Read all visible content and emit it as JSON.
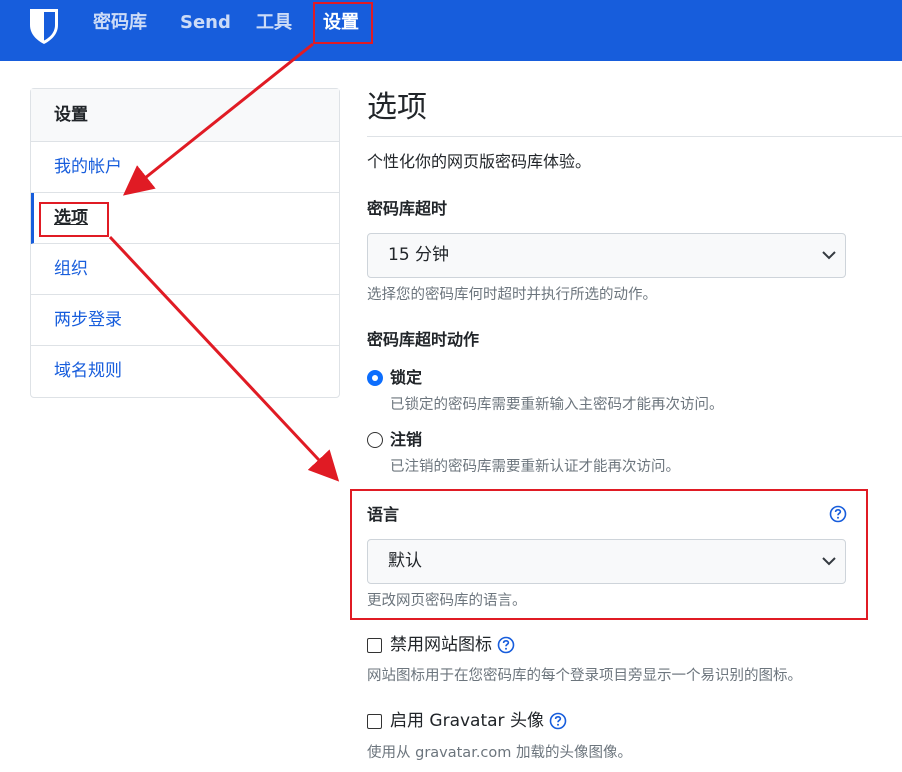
{
  "nav": {
    "items": [
      {
        "label": "密码库"
      },
      {
        "label": "Send"
      },
      {
        "label": "工具"
      },
      {
        "label": "设置"
      }
    ]
  },
  "sidebar": {
    "header": "设置",
    "items": [
      {
        "label": "我的帐户"
      },
      {
        "label": "选项"
      },
      {
        "label": "组织"
      },
      {
        "label": "两步登录"
      },
      {
        "label": "域名规则"
      }
    ]
  },
  "main": {
    "title": "选项",
    "intro": "个性化你的网页版密码库体验。",
    "vault_timeout": {
      "label": "密码库超时",
      "value": "15 分钟",
      "help": "选择您的密码库何时超时并执行所选的动作。"
    },
    "timeout_action": {
      "label": "密码库超时动作",
      "options": [
        {
          "label": "锁定",
          "help": "已锁定的密码库需要重新输入主密码才能再次访问。",
          "checked": true
        },
        {
          "label": "注销",
          "help": "已注销的密码库需要重新认证才能再次访问。",
          "checked": false
        }
      ]
    },
    "language": {
      "label": "语言",
      "value": "默认",
      "help": "更改网页密码库的语言。"
    },
    "disable_favicon": {
      "label": "禁用网站图标",
      "help": "网站图标用于在您密码库的每个登录项目旁显示一个易识别的图标。"
    },
    "gravatar": {
      "label": "启用 Gravatar 头像",
      "help": "使用从 gravatar.com 加载的头像图像。"
    }
  },
  "colors": {
    "brand": "#175ddc",
    "annotation": "#e01b24"
  }
}
